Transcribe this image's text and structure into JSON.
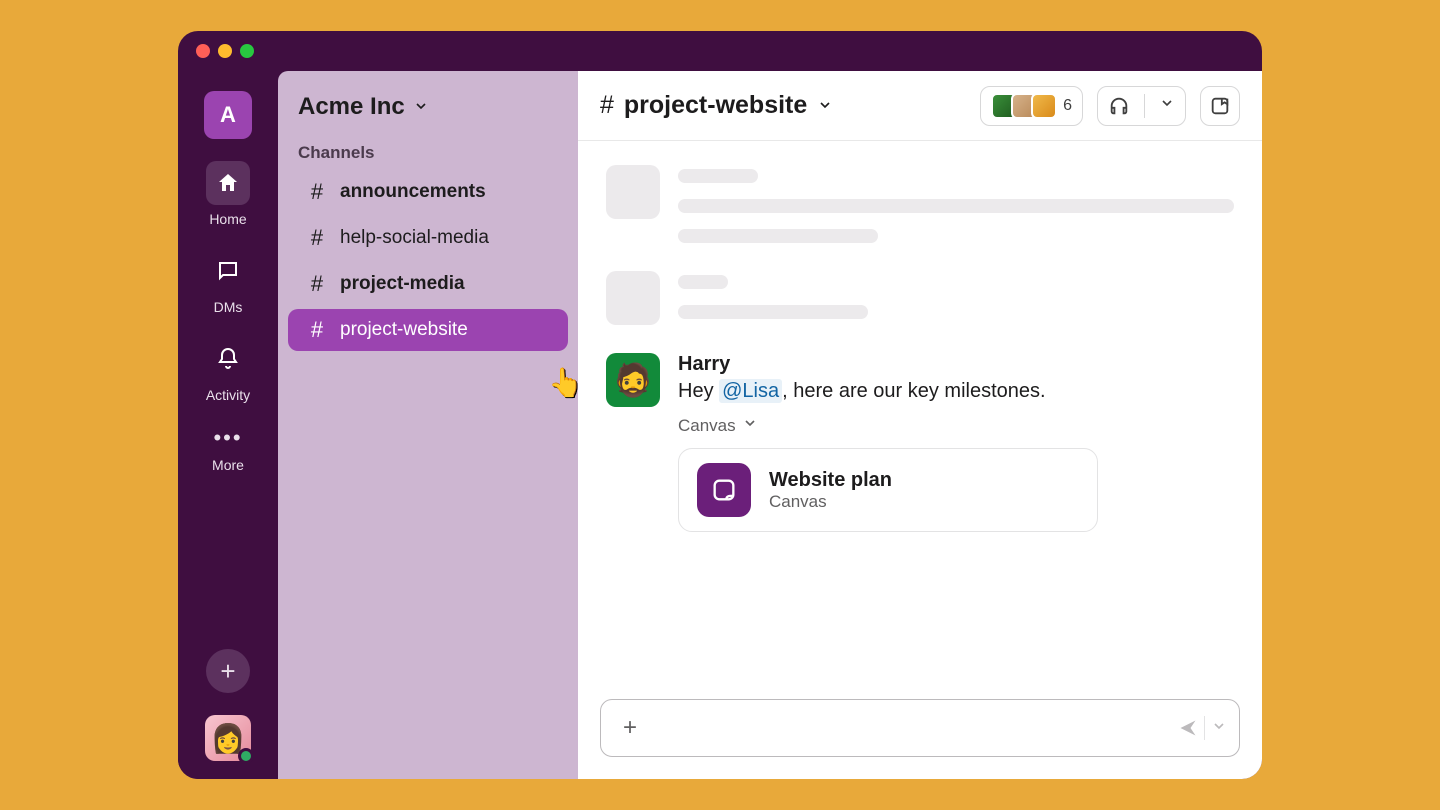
{
  "workspace": {
    "initial": "A",
    "name": "Acme Inc"
  },
  "rail": {
    "home": "Home",
    "dms": "DMs",
    "activity": "Activity",
    "more": "More"
  },
  "sidebar": {
    "section": "Channels",
    "channels": [
      {
        "name": "announcements",
        "bold": true,
        "selected": false
      },
      {
        "name": "help-social-media",
        "bold": false,
        "selected": false
      },
      {
        "name": "project-media",
        "bold": true,
        "selected": false
      },
      {
        "name": "project-website",
        "bold": false,
        "selected": true
      }
    ]
  },
  "header": {
    "channel": "project-website",
    "member_count": "6"
  },
  "message": {
    "author": "Harry",
    "text_before": "Hey ",
    "mention": "@Lisa",
    "text_after": ", here are our key milestones.",
    "attach_label": "Canvas",
    "attach_title": "Website plan",
    "attach_sub": "Canvas"
  }
}
